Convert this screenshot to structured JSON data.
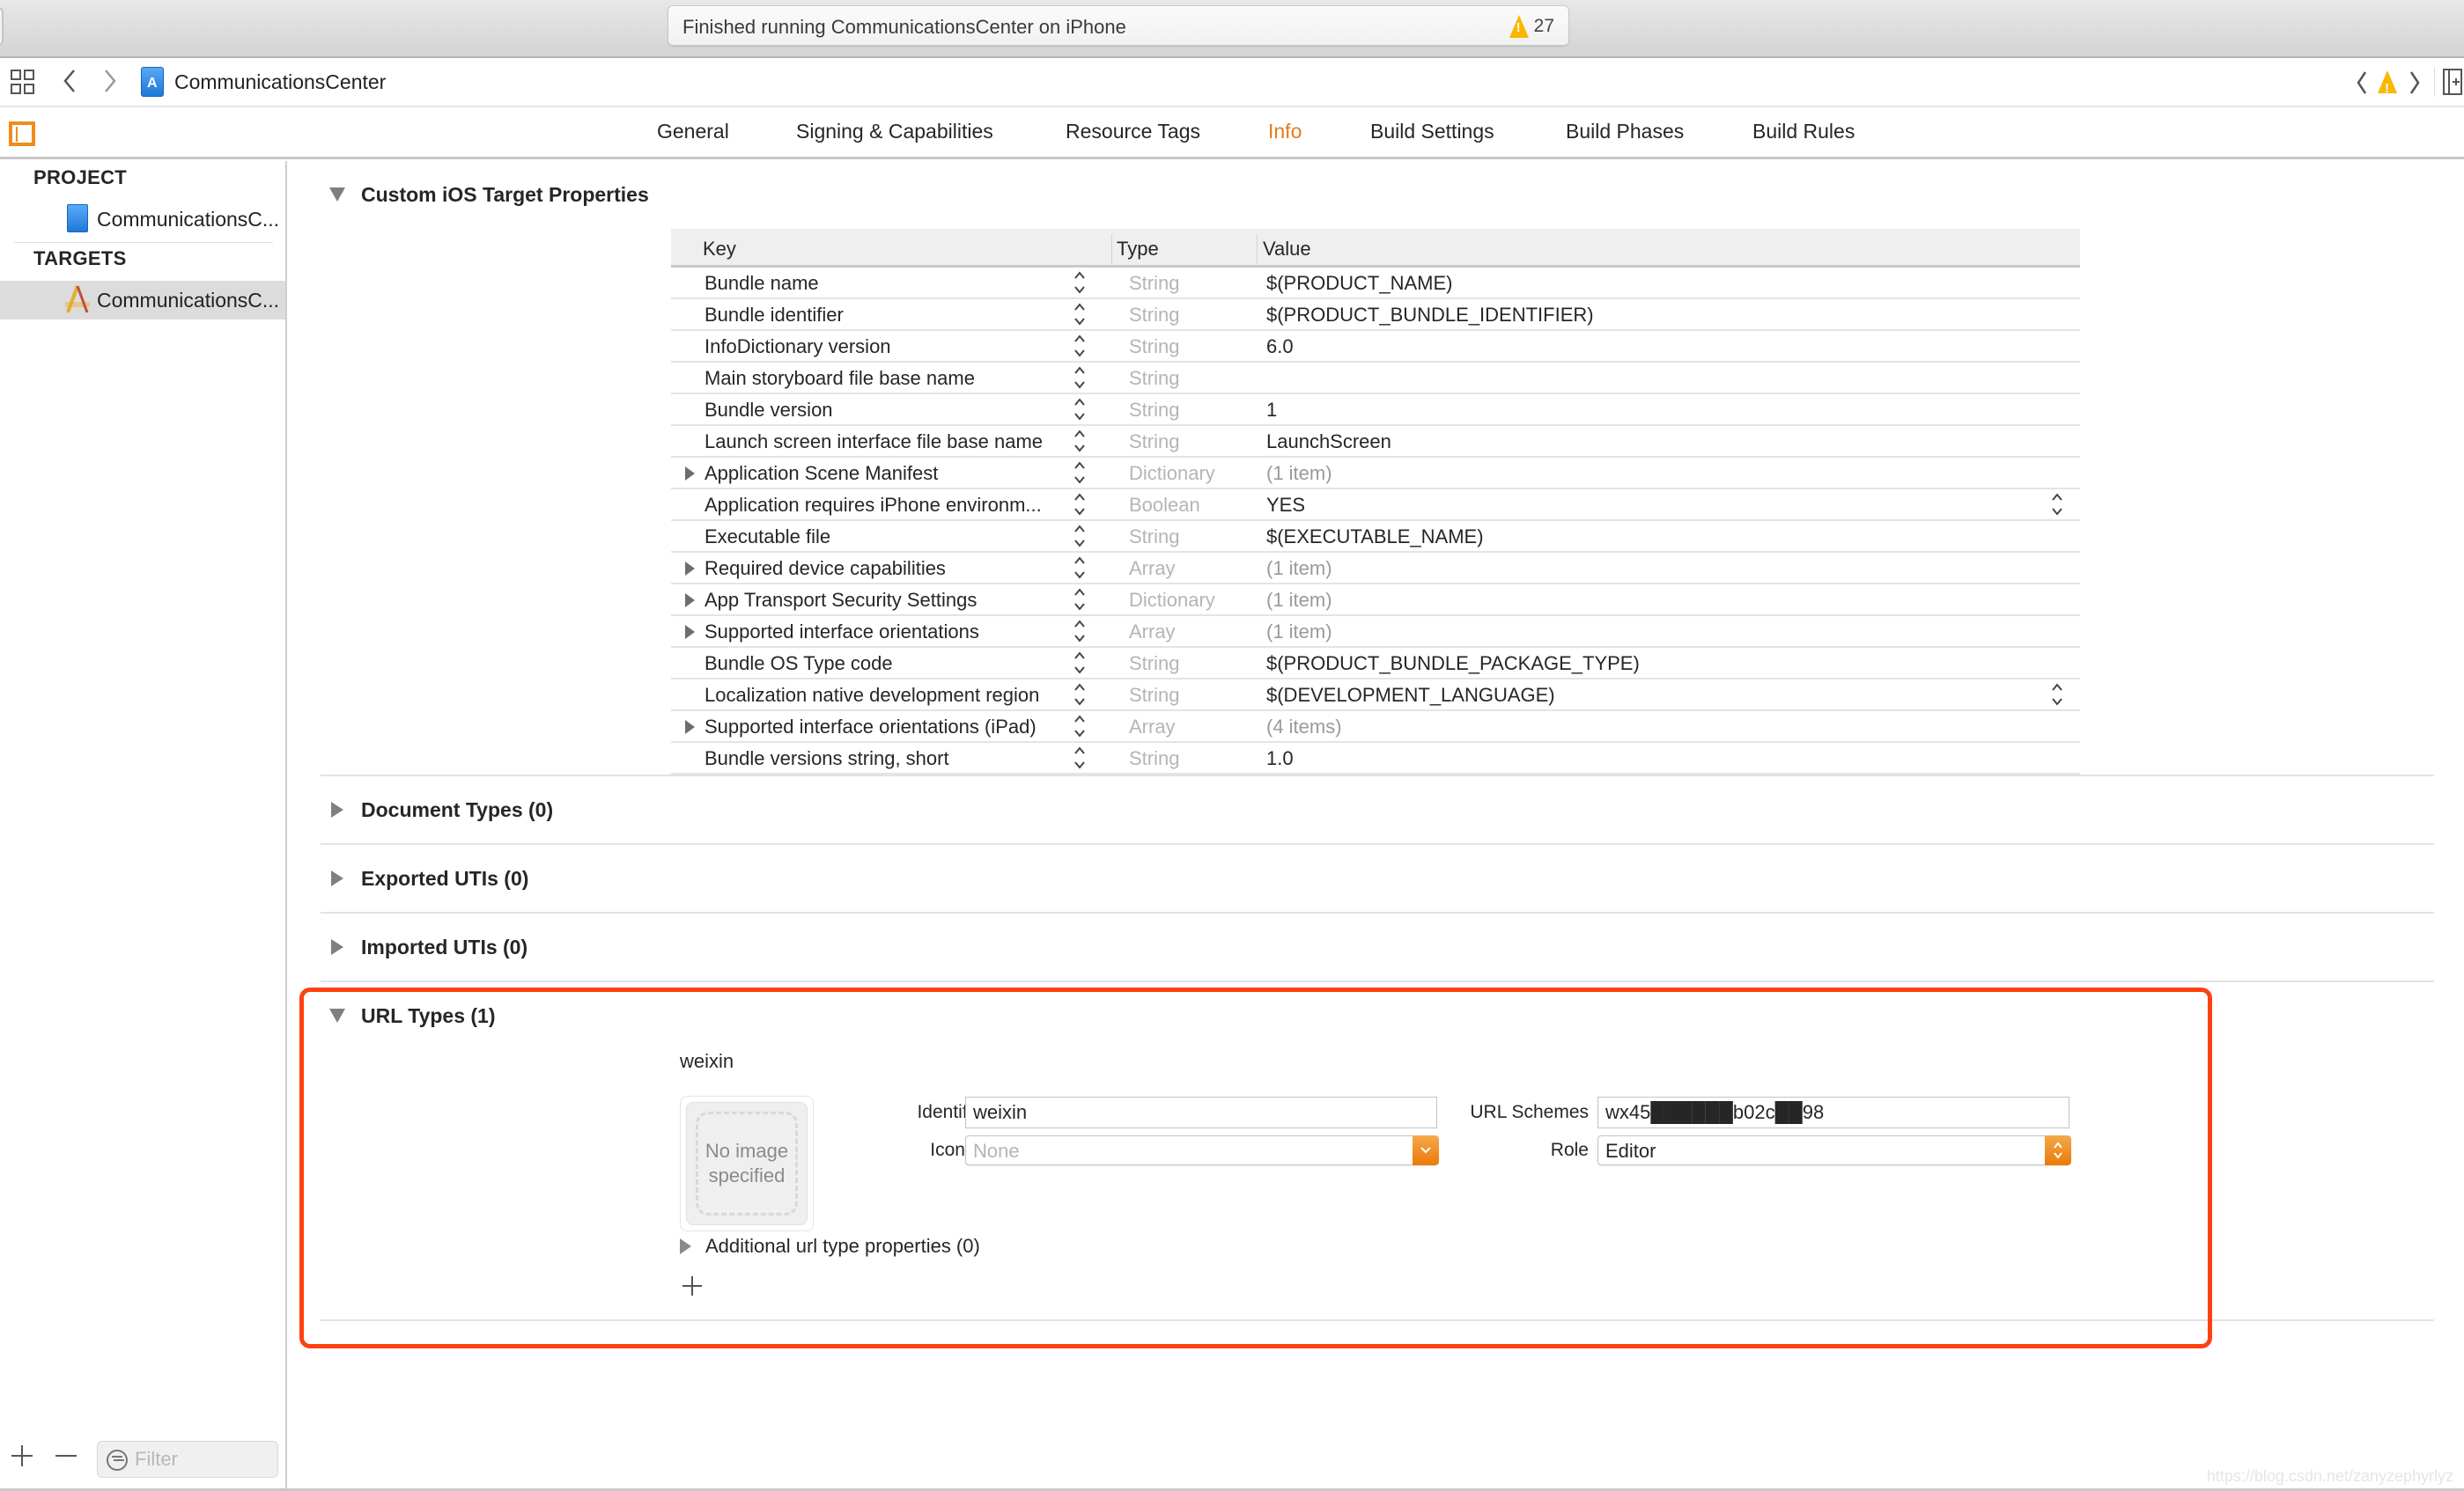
{
  "titlebar": {
    "status_text": "Finished running CommunicationsCenter on iPhone",
    "warning_count": "27"
  },
  "navbar": {
    "title": "CommunicationsCenter",
    "back_icon": "chevron-left-icon",
    "forward_icon": "chevron-right-icon"
  },
  "tabs": [
    {
      "label": "General",
      "active": false
    },
    {
      "label": "Signing & Capabilities",
      "active": false
    },
    {
      "label": "Resource Tags",
      "active": false
    },
    {
      "label": "Info",
      "active": true
    },
    {
      "label": "Build Settings",
      "active": false
    },
    {
      "label": "Build Phases",
      "active": false
    },
    {
      "label": "Build Rules",
      "active": false
    }
  ],
  "sidebar": {
    "project_heading": "PROJECT",
    "project_item": "CommunicationsC...",
    "targets_heading": "TARGETS",
    "target_item": "CommunicationsC...",
    "filter_placeholder": "Filter"
  },
  "sections": {
    "custom_properties": "Custom iOS Target Properties",
    "document_types": "Document Types (0)",
    "exported_utis": "Exported UTIs (0)",
    "imported_utis": "Imported UTIs (0)",
    "url_types": "URL Types (1)"
  },
  "table": {
    "headers": {
      "key": "Key",
      "type": "Type",
      "value": "Value"
    },
    "rows": [
      {
        "key": "Bundle name",
        "type": "String",
        "value": "$(PRODUCT_NAME)",
        "expandable": false,
        "muted": false
      },
      {
        "key": "Bundle identifier",
        "type": "String",
        "value": "$(PRODUCT_BUNDLE_IDENTIFIER)",
        "expandable": false,
        "muted": false
      },
      {
        "key": "InfoDictionary version",
        "type": "String",
        "value": "6.0",
        "expandable": false,
        "muted": false
      },
      {
        "key": "Main storyboard file base name",
        "type": "String",
        "value": "",
        "expandable": false,
        "muted": false
      },
      {
        "key": "Bundle version",
        "type": "String",
        "value": "1",
        "expandable": false,
        "muted": false
      },
      {
        "key": "Launch screen interface file base name",
        "type": "String",
        "value": "LaunchScreen",
        "expandable": false,
        "muted": false
      },
      {
        "key": "Application Scene Manifest",
        "type": "Dictionary",
        "value": "(1 item)",
        "expandable": true,
        "muted": true
      },
      {
        "key": "Application requires iPhone environm...",
        "type": "Boolean",
        "value": "YES",
        "expandable": false,
        "muted": false,
        "value_stepper": true
      },
      {
        "key": "Executable file",
        "type": "String",
        "value": "$(EXECUTABLE_NAME)",
        "expandable": false,
        "muted": false
      },
      {
        "key": "Required device capabilities",
        "type": "Array",
        "value": "(1 item)",
        "expandable": true,
        "muted": true
      },
      {
        "key": "App Transport Security Settings",
        "type": "Dictionary",
        "value": "(1 item)",
        "expandable": true,
        "muted": true
      },
      {
        "key": "Supported interface orientations",
        "type": "Array",
        "value": "(1 item)",
        "expandable": true,
        "muted": true
      },
      {
        "key": "Bundle OS Type code",
        "type": "String",
        "value": "$(PRODUCT_BUNDLE_PACKAGE_TYPE)",
        "expandable": false,
        "muted": false
      },
      {
        "key": "Localization native development region",
        "type": "String",
        "value": "$(DEVELOPMENT_LANGUAGE)",
        "expandable": false,
        "muted": false,
        "value_stepper": true
      },
      {
        "key": "Supported interface orientations (iPad)",
        "type": "Array",
        "value": "(4 items)",
        "expandable": true,
        "muted": true
      },
      {
        "key": "Bundle versions string, short",
        "type": "String",
        "value": "1.0",
        "expandable": false,
        "muted": false
      }
    ]
  },
  "url_type": {
    "name": "weixin",
    "image_placeholder": "No image specified",
    "identifier_label": "Identifier",
    "identifier_value": "weixin",
    "icon_label": "Icon",
    "icon_value": "None",
    "url_schemes_label": "URL Schemes",
    "url_schemes_value": "wx45██████b02c██98",
    "role_label": "Role",
    "role_value": "Editor",
    "additional_properties": "Additional url type properties (0)"
  },
  "colors": {
    "accent": "#e07c1a",
    "highlight_border": "#fe4110",
    "warning": "#f9b800"
  },
  "watermark": "https://blog.csdn.net/zanyzephyrlyz"
}
